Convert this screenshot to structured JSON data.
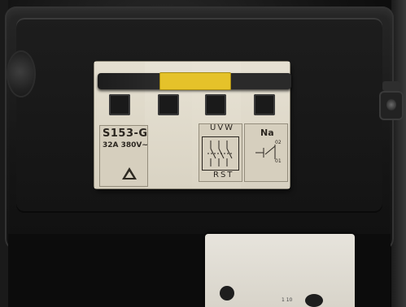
{
  "breaker": {
    "model": "S153-G",
    "rating": "32A 380V~",
    "top_marking": "UVW",
    "bottom_marking": "RST",
    "aux_label": "Na",
    "aux_terminal_top": "02",
    "aux_terminal_bottom": "01"
  },
  "socket": {
    "label": "1 10"
  },
  "colors": {
    "toggle_cap": "#e5c22a",
    "breaker_body": "#dcd6c6",
    "enclosure": "#161616"
  }
}
